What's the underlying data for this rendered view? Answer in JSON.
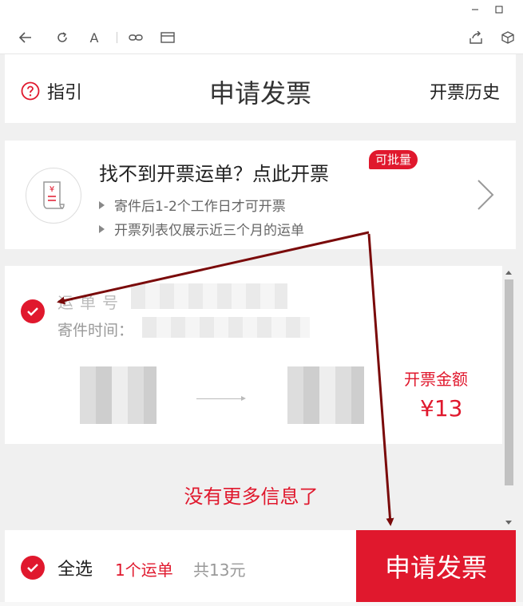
{
  "window": {
    "minimize_icon": "minimize-icon",
    "maximize_icon": "maximize-icon"
  },
  "browser_bar": {
    "icons": [
      "back-arrow-icon",
      "refresh-icon",
      "font-icon",
      "link-icon",
      "reader-icon",
      "share-icon",
      "cube-icon"
    ],
    "font_glyph": "A"
  },
  "header": {
    "guide_label": "指引",
    "title": "申请发票",
    "history_label": "开票历史"
  },
  "banner": {
    "title": "找不到开票运单？点此开票",
    "badge": "可批量",
    "bullets": [
      "寄件后1-2个工作日才可开票",
      "开票列表仅展示近三个月的运单"
    ],
    "receipt_glyph": "¥"
  },
  "order": {
    "waybill_label": "运单号",
    "send_time_label": "寄件时间：",
    "amount_label": "开票金额",
    "amount_value": "¥13",
    "selected": true
  },
  "no_more_text": "没有更多信息了",
  "footer": {
    "select_all_label": "全选",
    "count_text": "1个运单",
    "total_text": "共13元",
    "apply_button": "申请发票"
  },
  "colors": {
    "accent": "#e0182d",
    "annotation_arrow": "#7a0a0a"
  }
}
